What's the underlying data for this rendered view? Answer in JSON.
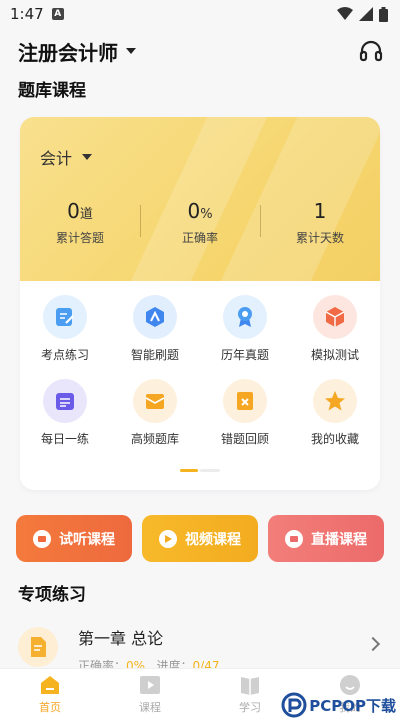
{
  "status_bar": {
    "time": "1:47"
  },
  "header": {
    "exam_title": "注册会计师"
  },
  "bank_section": {
    "title": "题库课程"
  },
  "card": {
    "subject": "会计",
    "stats": [
      {
        "value": "0",
        "unit": "道",
        "label": "累计答题"
      },
      {
        "value": "0",
        "unit": "%",
        "label": "正确率"
      },
      {
        "value": "1",
        "unit": "",
        "label": "累计天数"
      }
    ],
    "grid": [
      {
        "label": "考点练习",
        "icon": "edit-note-icon"
      },
      {
        "label": "智能刷题",
        "icon": "smart-drill-icon"
      },
      {
        "label": "历年真题",
        "icon": "award-ribbon-icon"
      },
      {
        "label": "模拟测试",
        "icon": "box-cube-icon"
      },
      {
        "label": "每日一练",
        "icon": "calendar-list-icon"
      },
      {
        "label": "高频题库",
        "icon": "mail-tray-icon"
      },
      {
        "label": "错题回顾",
        "icon": "wrong-book-icon"
      },
      {
        "label": "我的收藏",
        "icon": "star-icon"
      }
    ]
  },
  "courses": [
    {
      "label": "试听课程",
      "color": "#f0703d"
    },
    {
      "label": "视频课程",
      "color": "#f5b322"
    },
    {
      "label": "直播课程",
      "color": "#ef7472"
    }
  ],
  "special_section": {
    "title": "专项练习"
  },
  "chapter": {
    "title": "第一章 总论",
    "accuracy_label": "正确率：",
    "accuracy_value": "0%",
    "progress_label": "进度：",
    "progress_value": "0/47"
  },
  "tabbar": {
    "tabs": [
      "首页",
      "课程",
      "学习",
      "我的"
    ],
    "active_index": 0
  },
  "watermark": {
    "text": "PCPOP下载"
  },
  "colors": {
    "accent": "#f5a623",
    "card_yellow": "#f6d66f"
  }
}
